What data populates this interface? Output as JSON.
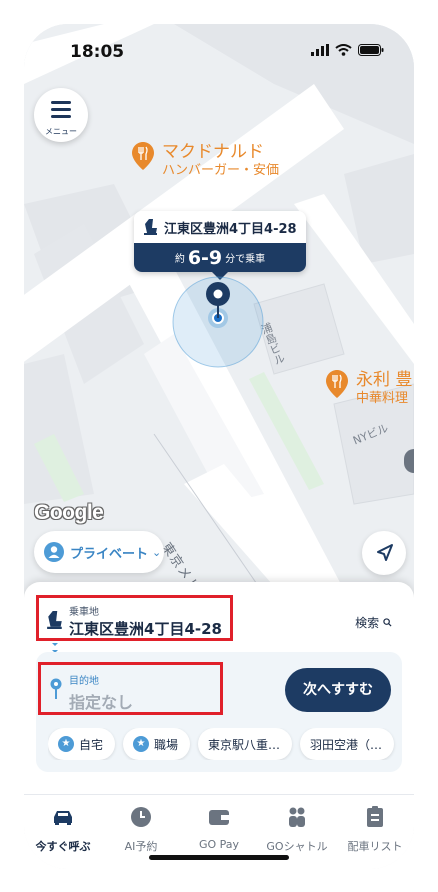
{
  "status_bar": {
    "time": "18:05"
  },
  "map": {
    "menu_label": "メニュー",
    "street_labels": [
      "浦島ビル",
      "NYビル",
      "東京メトロ有楽町"
    ],
    "poi_1": {
      "name": "マクドナルド",
      "category": "ハンバーガー・安価"
    },
    "poi_2": {
      "name": "永利 豊",
      "category": "中華料理"
    },
    "pickup_bubble": {
      "address": "江東区豊洲4丁目4-28",
      "prefix": "約",
      "eta": "6-9",
      "suffix": "分で乗車"
    },
    "google_logo": "Google",
    "ride_type": "プライベート",
    "colors": {
      "poi": "#e8892c",
      "pin": "#1d3b63",
      "accent": "#3a85c4"
    }
  },
  "panel": {
    "pickup_label": "乗車地",
    "pickup_value": "江東区豊洲4丁目4-28",
    "search_label": "検索",
    "destination_label": "目的地",
    "destination_placeholder": "指定なし",
    "next_button": "次へすすむ",
    "shortcuts": [
      "自宅",
      "職場",
      "東京駅八重…",
      "羽田空港（…"
    ]
  },
  "tabbar": {
    "active": "今すぐ呼ぶ",
    "items": [
      "今すぐ呼ぶ",
      "AI予約",
      "GO Pay",
      "GOシャトル",
      "配車リスト"
    ]
  }
}
